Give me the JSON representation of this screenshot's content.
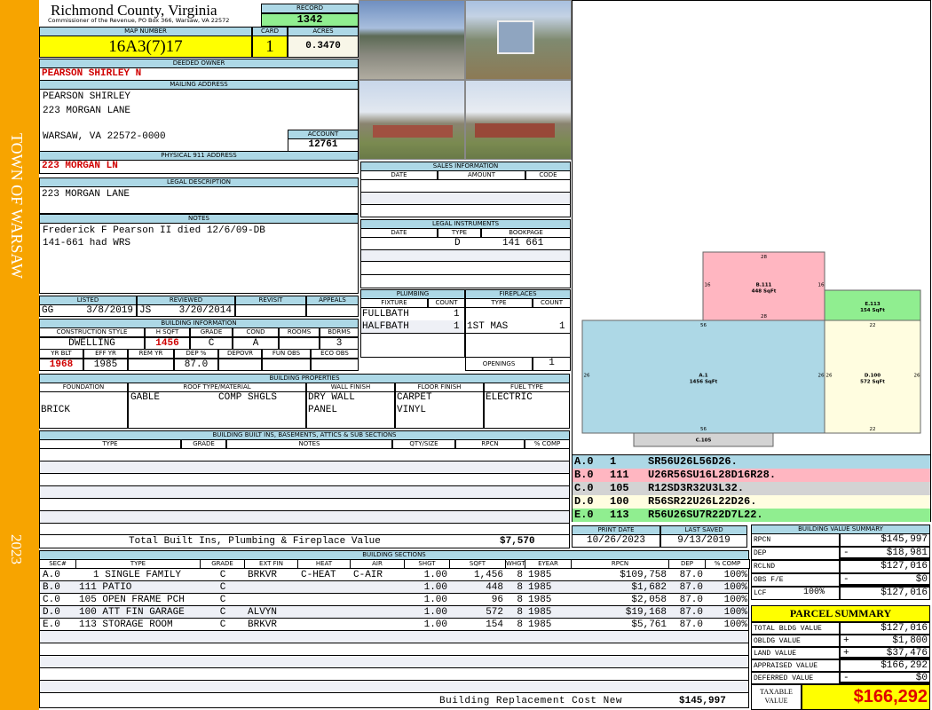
{
  "side": {
    "town": "TOWN OF WARSAW",
    "year": "2023"
  },
  "header": {
    "county": "Richmond County, Virginia",
    "subtitle": "Commissioner of the Revenue, PO Box 366, Warsaw, VA 22572",
    "record_label": "RECORD",
    "record": "1342"
  },
  "map": {
    "map_label": "MAP NUMBER",
    "map_number": "16A3(7)17",
    "card_label": "CARD",
    "card": "1",
    "acres_label": "ACRES",
    "acres": "0.3470"
  },
  "owner": {
    "label": "DEEDED OWNER",
    "name": "PEARSON SHIRLEY N"
  },
  "mailing": {
    "label": "MAILING ADDRESS",
    "line1": "PEARSON SHIRLEY",
    "line2": "223 MORGAN LANE",
    "line3": "WARSAW, VA 22572-0000",
    "account_label": "ACCOUNT",
    "account": "12761"
  },
  "physical": {
    "label": "PHYSICAL 911 ADDRESS",
    "value": "223 MORGAN LN"
  },
  "legal": {
    "label": "LEGAL DESCRIPTION",
    "value": "223 MORGAN LANE"
  },
  "notes": {
    "label": "NOTES",
    "line1": "Frederick F Pearson II died 12/6/09-DB",
    "line2": "141-661 had WRS"
  },
  "listing": {
    "listed_label": "LISTED",
    "reviewed_label": "REVIEWED",
    "revisit_label": "REVISIT",
    "appeals_label": "APPEALS",
    "listed_by": "GG",
    "listed_date": "3/8/2019",
    "reviewed_by": "JS",
    "reviewed_date": "3/20/2014"
  },
  "building_info": {
    "label": "BUILDING INFORMATION",
    "h1": [
      "CONSTRUCTION STYLE",
      "H SQFT",
      "GRADE",
      "COND",
      "ROOMS",
      "BDRMS"
    ],
    "v1": [
      "DWELLING",
      "1456",
      "C",
      "A",
      "",
      "3"
    ],
    "h2": [
      "YR BLT",
      "EFF YR",
      "REM YR",
      "DEP %",
      "DEPOVR",
      "FUN OBS",
      "ECO OBS"
    ],
    "v2": [
      "1968",
      "1985",
      "",
      "87.0",
      "",
      "",
      ""
    ]
  },
  "sales": {
    "label": "SALES INFORMATION",
    "cols": [
      "DATE",
      "AMOUNT",
      "CODE"
    ]
  },
  "legal_instruments": {
    "label": "LEGAL INSTRUMENTS",
    "cols": [
      "DATE",
      "TYPE",
      "BOOKPAGE"
    ],
    "type": "D",
    "bookpage": "141 661"
  },
  "plumbing": {
    "label": "PLUMBING",
    "cols": [
      "FIXTURE",
      "COUNT"
    ],
    "rows": [
      [
        "FULLBATH",
        "1"
      ],
      [
        "HALFBATH",
        "1"
      ]
    ]
  },
  "fireplaces": {
    "label": "FIREPLACES",
    "cols": [
      "TYPE",
      "COUNT"
    ],
    "type": "1ST MAS",
    "count": "1",
    "openings_label": "OPENINGS",
    "openings": "1"
  },
  "properties": {
    "label": "BUILDING PROPERTIES",
    "cols": [
      "FOUNDATION",
      "ROOF TYPE/MATERIAL",
      "WALL FINISH",
      "FLOOR FINISH",
      "FUEL TYPE"
    ],
    "foundation": "BRICK",
    "roof_type": "GABLE",
    "roof_material": "COMP SHGLS",
    "wall": [
      "DRY WALL",
      "PANEL"
    ],
    "floor": [
      "CARPET",
      "VINYL"
    ],
    "fuel": "ELECTRIC"
  },
  "builtins": {
    "label": "BUILDING BUILT INS, BASEMENTS, ATTICS & SUB SECTIONS",
    "cols": [
      "TYPE",
      "GRADE",
      "NOTES",
      "QTY/SIZE",
      "RPCN",
      "% COMP"
    ],
    "total_label": "Total Built Ins, Plumbing & Fireplace Value",
    "total": "$7,570"
  },
  "sections": {
    "label": "BUILDING SECTIONS",
    "cols": [
      "SEC#",
      "TYPE",
      "GRADE",
      "EXT FIN",
      "HEAT",
      "AIR",
      "SHGT",
      "SQFT",
      "WHGT",
      "EYEAR",
      "RPCN",
      "DEP",
      "% COMP"
    ],
    "rows": [
      [
        "A.0",
        "1 SINGLE FAMILY",
        "C",
        "BRKVR",
        "C-HEAT",
        "C-AIR",
        "1.00",
        "1,456",
        "8",
        "1985",
        "$109,758",
        "87.0",
        "100%"
      ],
      [
        "B.0",
        "111 PATIO",
        "C",
        "",
        "",
        "",
        "1.00",
        "448",
        "8",
        "1985",
        "$1,682",
        "87.0",
        "100%"
      ],
      [
        "C.0",
        "105 OPEN FRAME PCH",
        "C",
        "",
        "",
        "",
        "1.00",
        "96",
        "8",
        "1985",
        "$2,058",
        "87.0",
        "100%"
      ],
      [
        "D.0",
        "100 ATT FIN GARAGE",
        "C",
        "ALVYN",
        "",
        "",
        "1.00",
        "572",
        "8",
        "1985",
        "$19,168",
        "87.0",
        "100%"
      ],
      [
        "E.0",
        "113 STORAGE ROOM",
        "C",
        "BRKVR",
        "",
        "",
        "1.00",
        "154",
        "8",
        "1985",
        "$5,761",
        "87.0",
        "100%"
      ]
    ],
    "total_label": "Building Replacement Cost New",
    "total": "$145,997"
  },
  "sketch": {
    "areas": [
      {
        "id": "A",
        "label": "A.1",
        "sqft": "1456 SqFt",
        "color": "#add8e6",
        "dims": [
          "56",
          "26",
          "56",
          "26"
        ]
      },
      {
        "id": "B",
        "label": "B.111",
        "sqft": "448 SqFt",
        "color": "#ffb6c1",
        "dims": [
          "28",
          "16",
          "28",
          "16"
        ]
      },
      {
        "id": "C",
        "label": "C.105",
        "sqft": "",
        "color": "#d3d3d3",
        "dims": []
      },
      {
        "id": "D",
        "label": "D.100",
        "sqft": "572 SqFt",
        "color": "#fffde0",
        "dims": [
          "22",
          "26",
          "22",
          "26"
        ]
      },
      {
        "id": "E",
        "label": "E.113",
        "sqft": "154 SqFt",
        "color": "#90ee90",
        "dims": []
      }
    ],
    "vectors": [
      [
        "A.0",
        "1",
        "SR56U26L56D26.",
        "#add8e6"
      ],
      [
        "B.0",
        "111",
        "U26R56SU16L28D16R28.",
        "#ffb6c1"
      ],
      [
        "C.0",
        "105",
        "R12SD3R32U3L32.",
        "#d3d3d3"
      ],
      [
        "D.0",
        "100",
        "R56SR22U26L22D26.",
        "#fffde0"
      ],
      [
        "E.0",
        "113",
        "R56U26SU7R22D7L22.",
        "#90ee90"
      ]
    ]
  },
  "dates": {
    "print_label": "PRINT DATE",
    "print": "10/26/2023",
    "saved_label": "LAST SAVED",
    "saved": "9/13/2019"
  },
  "value_summary": {
    "label": "BUILDING VALUE SUMMARY",
    "rows": [
      [
        "RPCN",
        "",
        "",
        "$145,997"
      ],
      [
        "DEP",
        "",
        "-",
        "$18,981"
      ],
      [
        "RCLND",
        "",
        "",
        "$127,016"
      ],
      [
        "OBS F/E",
        "",
        "-",
        "$0"
      ],
      [
        "LCF",
        "100%",
        "",
        "$127,016"
      ]
    ]
  },
  "parcel": {
    "label": "PARCEL SUMMARY",
    "rows": [
      [
        "TOTAL BLDG VALUE",
        "",
        "$127,016"
      ],
      [
        "OBLDG VALUE",
        "+",
        "$1,800"
      ],
      [
        "LAND VALUE",
        "+",
        "$37,476"
      ],
      [
        "APPRAISED VALUE",
        "",
        "$166,292"
      ],
      [
        "DEFERRED VALUE",
        "-",
        "$0"
      ]
    ],
    "taxable_label": "TAXABLE VALUE",
    "taxable": "$166,292"
  },
  "colors": {
    "header": "#add8e6",
    "stripe": "#f7a400",
    "highlight": "#ffff00",
    "record": "#90ee90",
    "alert": "#d00000"
  }
}
